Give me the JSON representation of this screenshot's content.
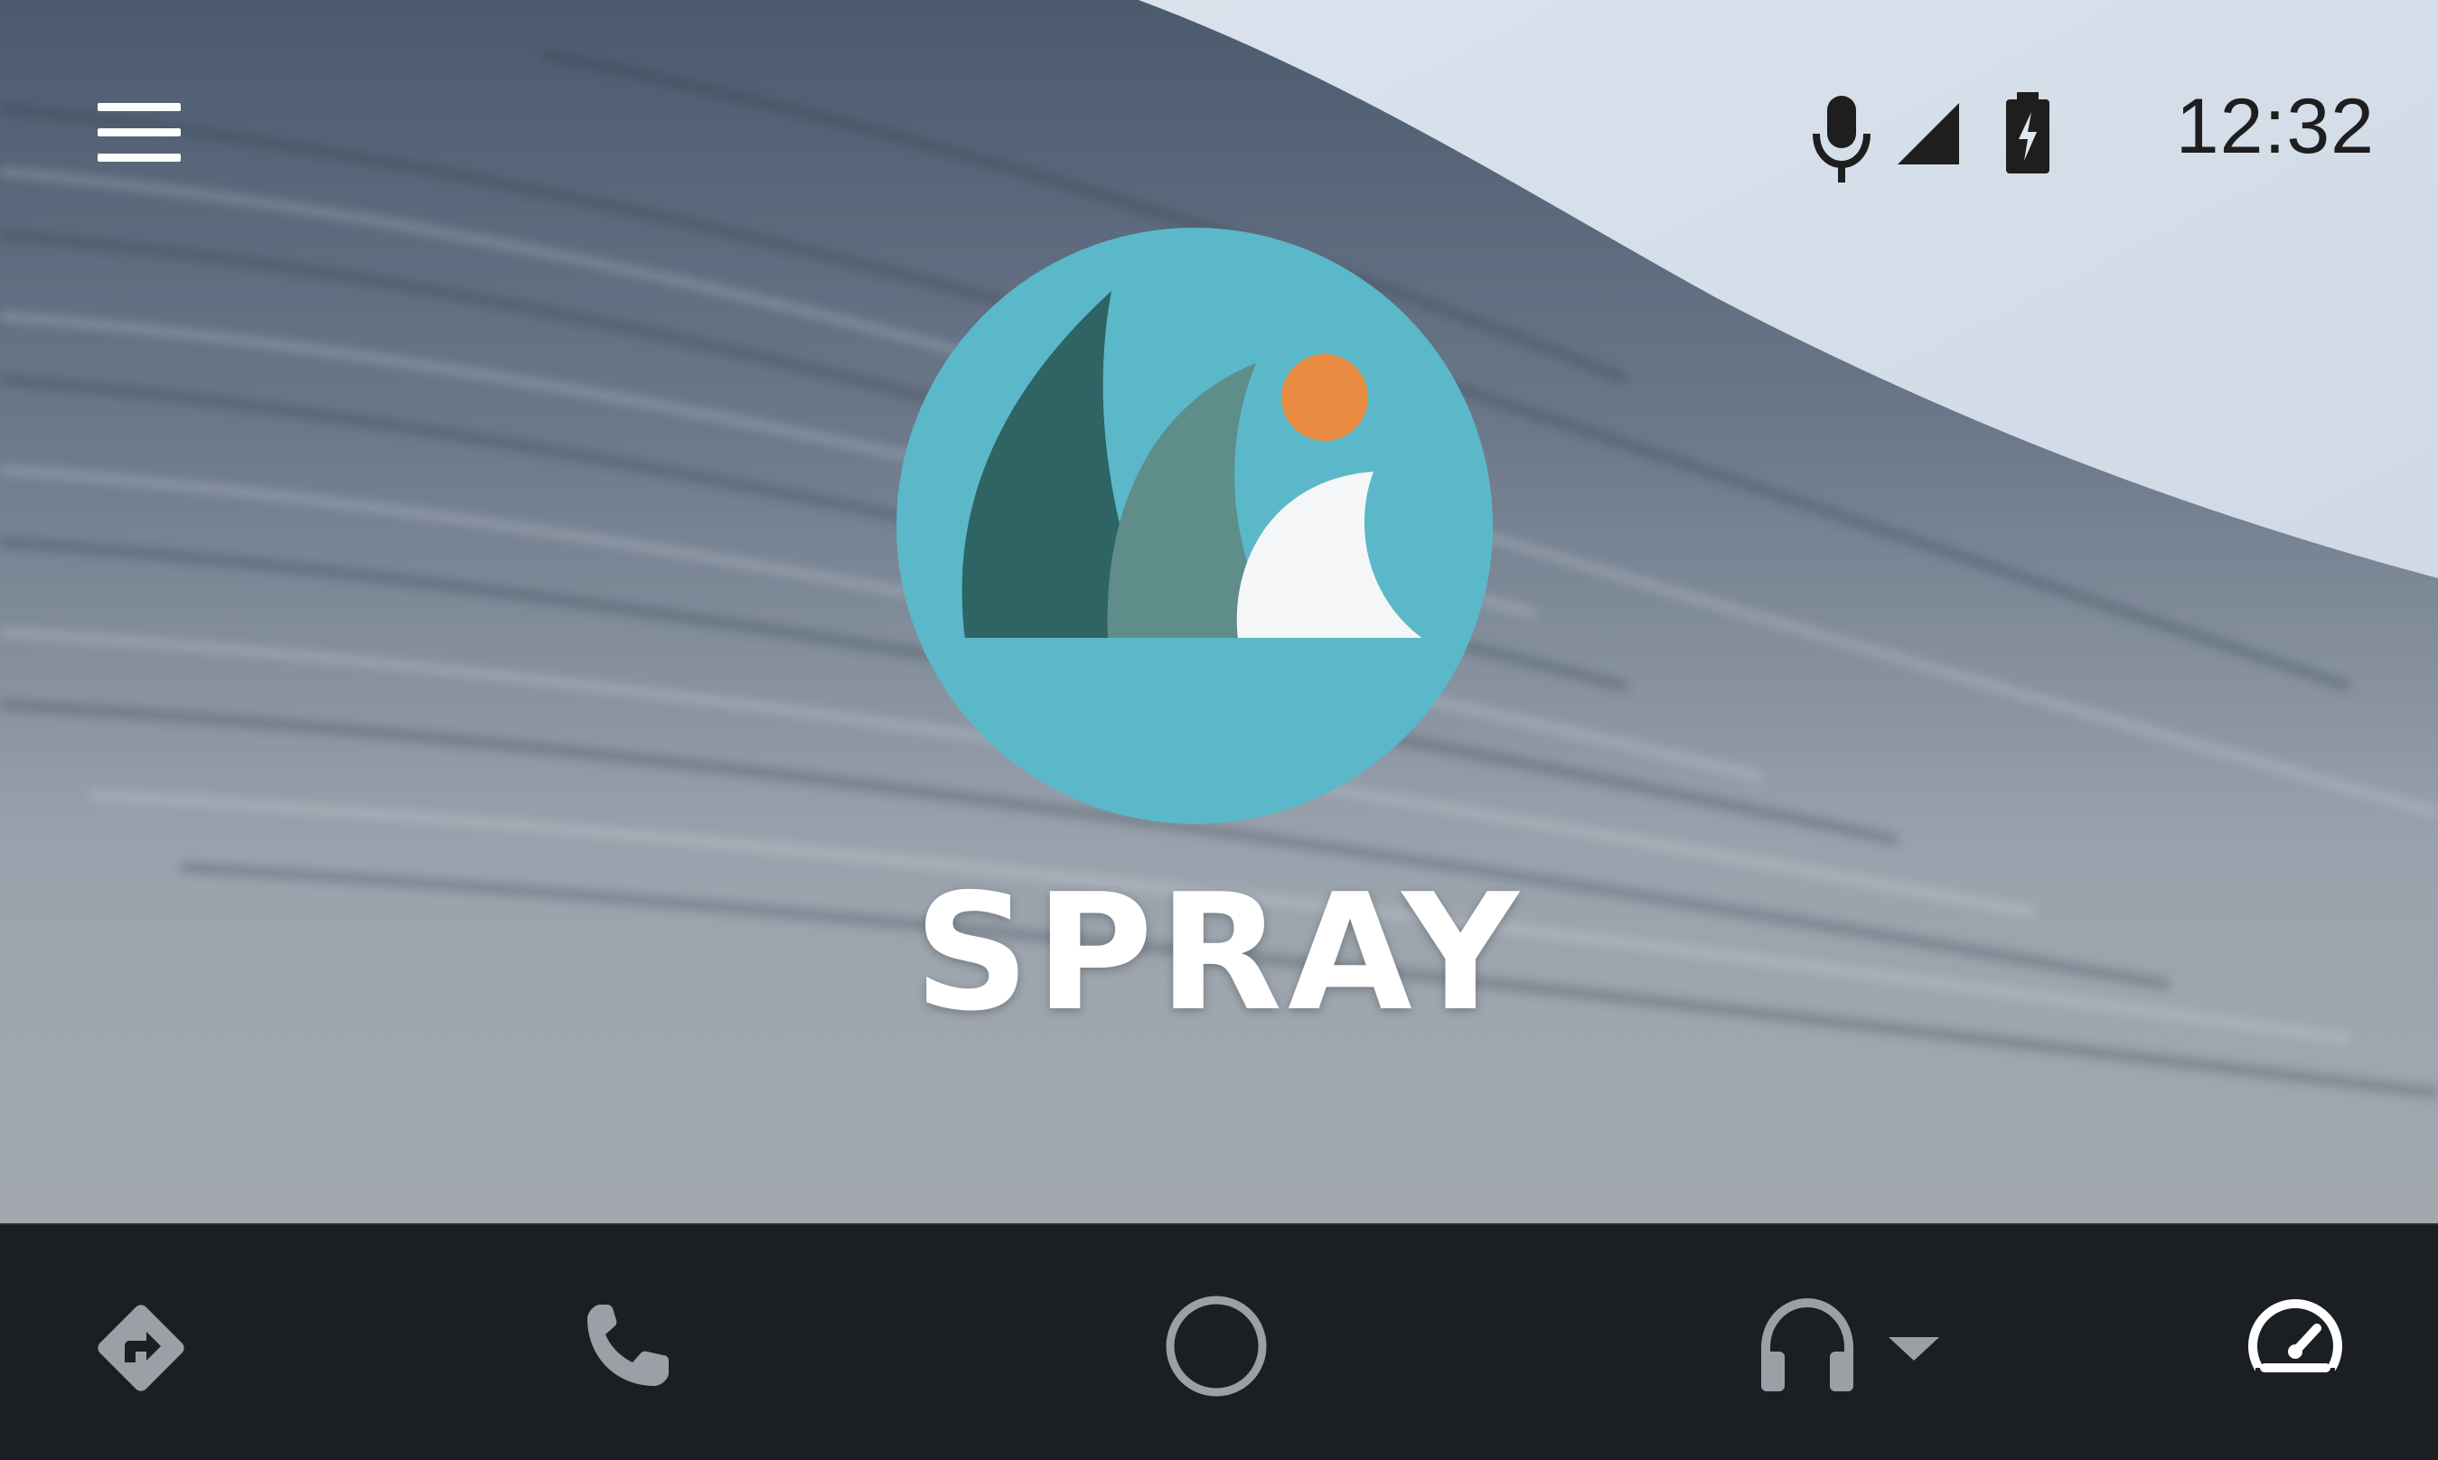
{
  "status_bar": {
    "time": "12:32",
    "icons": [
      "mic-icon",
      "cell-signal-icon",
      "battery-charging-icon"
    ]
  },
  "app": {
    "name": "SPRAY",
    "logo": "spray-wave-logo"
  },
  "colors": {
    "logo_circle": "#5bb8c8",
    "wave_dark": "#2e6464",
    "wave_mid": "#5e8d8a",
    "wave_light": "#f4f6f7",
    "sun": "#e88b40",
    "nav_bg": "#1b1f24",
    "nav_icon": "#9aa0a6"
  },
  "nav": {
    "items": [
      {
        "id": "navigation",
        "icon": "navigation-directions-icon"
      },
      {
        "id": "phone",
        "icon": "phone-icon"
      },
      {
        "id": "home",
        "icon": "home-circle-icon"
      },
      {
        "id": "media",
        "icon": "headphones-icon",
        "has_dropdown": true
      },
      {
        "id": "overview",
        "icon": "car-dashboard-icon"
      }
    ]
  }
}
